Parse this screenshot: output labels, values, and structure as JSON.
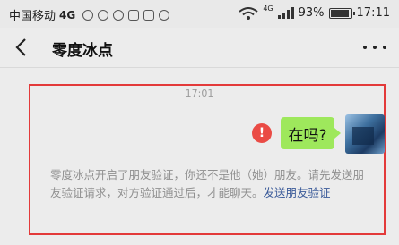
{
  "statusbar": {
    "carrier": "中国移动",
    "network": "4G",
    "mobile_type": "4G",
    "battery": "93%",
    "time": "17:11"
  },
  "header": {
    "title": "零度冰点",
    "icons": [
      "back-icon",
      "more-icon"
    ]
  },
  "chat": {
    "timestamp": "17:01",
    "message": {
      "text": "在吗?",
      "status": "failed",
      "error_symbol": "!"
    },
    "notice": {
      "text": "零度冰点开启了朋友验证，你还不是他（她）朋友。请先发送朋友验证请求，对方验证通过后，才能聊天。",
      "link": "发送朋友验证"
    }
  },
  "colors": {
    "bubble": "#9ee85c",
    "error": "#ea4b45",
    "highlight": "#e33a3a",
    "link": "#3a5a99"
  }
}
